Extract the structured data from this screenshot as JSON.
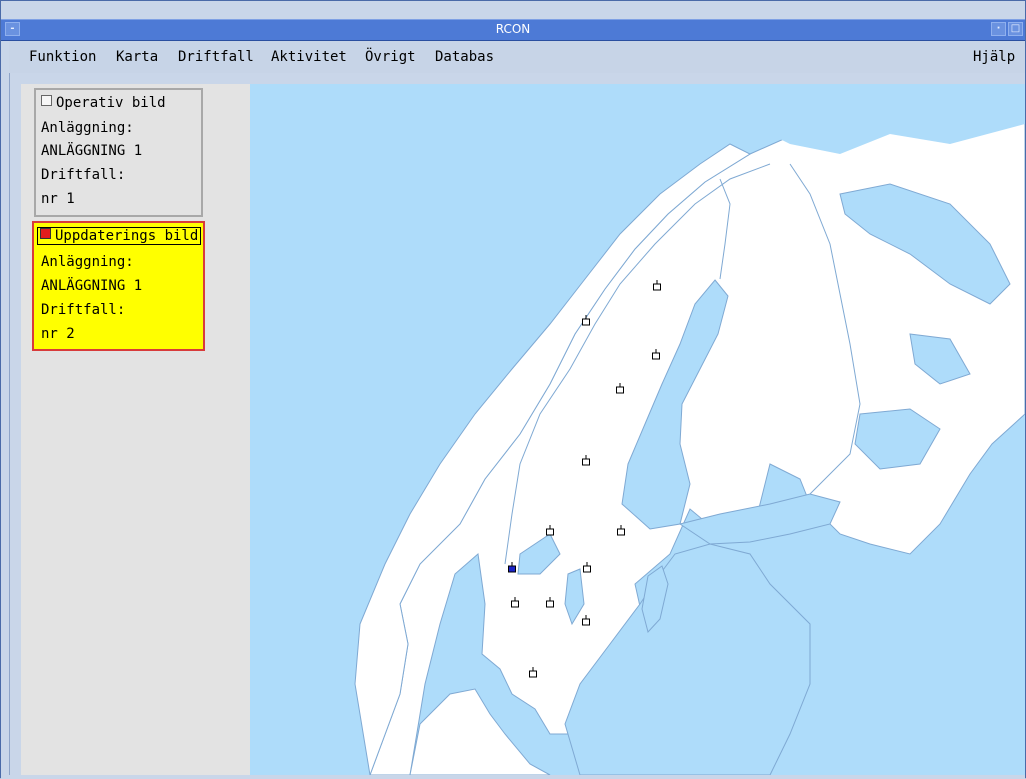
{
  "window": {
    "title": "RCON",
    "minimize_glyph": "-",
    "close_glyph": "",
    "restore_glyph": ""
  },
  "menu": [
    {
      "label": "Funktion"
    },
    {
      "label": "Karta"
    },
    {
      "label": "Driftfall"
    },
    {
      "label": "Aktivitet"
    },
    {
      "label": "Övrigt"
    },
    {
      "label": "Databas"
    }
  ],
  "help": "Hjälp",
  "panels": {
    "operativ": {
      "title": "Operativ bild",
      "l1": "Anläggning:",
      "l2": "ANLÄGGNING 1",
      "l3": "Driftfall:",
      "l4": "nr 1",
      "checked": false
    },
    "uppdatering": {
      "title": "Uppdaterings bild",
      "l1": "Anläggning:",
      "l2": "ANLÄGGNING 1",
      "l3": "Driftfall:",
      "l4": "nr 2",
      "checked": true
    }
  },
  "map": {
    "sea_color": "#aedcfa",
    "land_color": "#ffffff",
    "selected_marker_color": "#1a23c8",
    "markers": [
      {
        "id": "m1",
        "selected": false
      },
      {
        "id": "m2",
        "selected": false
      },
      {
        "id": "m3",
        "selected": false
      },
      {
        "id": "m4",
        "selected": false
      },
      {
        "id": "m5",
        "selected": false
      },
      {
        "id": "m6",
        "selected": false
      },
      {
        "id": "m7",
        "selected": false
      },
      {
        "id": "m8",
        "selected": true
      },
      {
        "id": "m9",
        "selected": false
      },
      {
        "id": "m10",
        "selected": false
      },
      {
        "id": "m11",
        "selected": false
      },
      {
        "id": "m12",
        "selected": false
      },
      {
        "id": "m13",
        "selected": false
      },
      {
        "id": "m14",
        "selected": false
      }
    ]
  }
}
